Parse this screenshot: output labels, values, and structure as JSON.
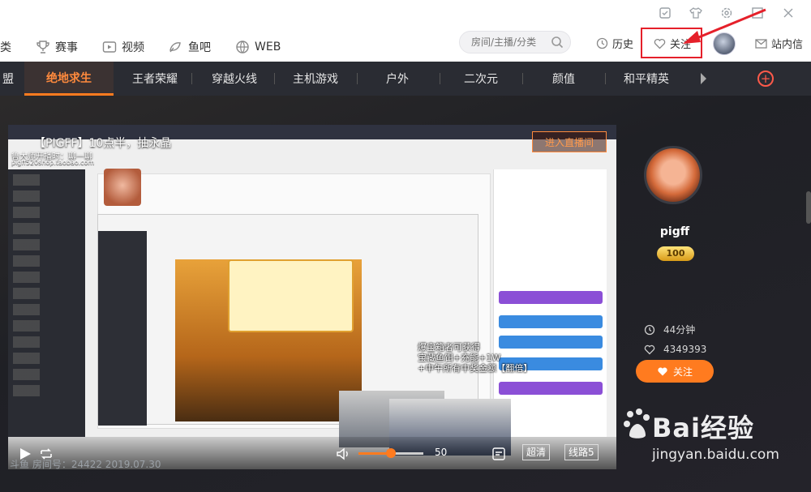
{
  "window": {
    "controls": [
      "check-square-icon",
      "shirt-icon",
      "gear-icon",
      "minimize-icon",
      "maximize-icon",
      "close-icon"
    ]
  },
  "nav": {
    "items": [
      {
        "label": "类",
        "icon": ""
      },
      {
        "label": "赛事",
        "icon": "trophy-icon"
      },
      {
        "label": "视频",
        "icon": "video-icon"
      },
      {
        "label": "鱼吧",
        "icon": "fish-icon"
      },
      {
        "label": "WEB",
        "icon": "globe-icon"
      }
    ]
  },
  "search": {
    "placeholder": "房间/主播/分类"
  },
  "header": {
    "history": "历史",
    "follow": "关注",
    "messages": "站内信"
  },
  "categories": [
    {
      "label": "盟",
      "active": false
    },
    {
      "label": "绝地求生",
      "active": true
    },
    {
      "label": "王者荣耀",
      "active": false
    },
    {
      "label": "穿越火线",
      "active": false
    },
    {
      "label": "主机游戏",
      "active": false
    },
    {
      "label": "户外",
      "active": false
    },
    {
      "label": "二次元",
      "active": false
    },
    {
      "label": "颜值",
      "active": false
    },
    {
      "label": "和平精英",
      "active": false
    }
  ],
  "player": {
    "title": "【PIGFF】10点半，抽永晶",
    "subtitle": "鲁大师开播时：聊一聊",
    "shop": "pigff520shop.taobao.com",
    "enter_room": "进入直播间",
    "danmu": [
      "爆宝箱者可获得",
      "宝藏鱼饵+充能+1W",
      "+中午所有中奖金额【翻倍】"
    ],
    "volume": 50,
    "quality": "超清",
    "line": "线路5",
    "overlay": "斗鱼 房间号：24422 2019.07.30"
  },
  "streamer": {
    "name": "pigff",
    "level": "100",
    "duration": "44分钟",
    "followers": "4349393",
    "follow_label": "关注"
  },
  "watermark": {
    "text": "Bai经验",
    "url": "jingyan.baidu.com"
  },
  "colors": {
    "accent": "#ff7b1f",
    "highlight": "#e5202a",
    "catbar": "#2a2c33"
  }
}
